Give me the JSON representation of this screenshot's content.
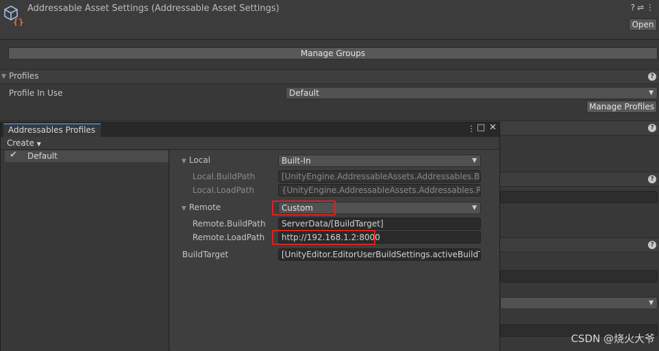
{
  "inspector": {
    "title": "Addressable Asset Settings (Addressable Asset Settings)",
    "open_label": "Open",
    "manage_groups_label": "Manage Groups"
  },
  "profiles_section": {
    "header": "Profiles",
    "profile_in_use_label": "Profile In Use",
    "profile_in_use_value": "Default",
    "manage_profiles_label": "Manage Profiles"
  },
  "profiles_window": {
    "tab_label": "Addressables Profiles",
    "create_label": "Create",
    "profiles": [
      {
        "name": "Default",
        "selected": true
      }
    ],
    "local": {
      "label": "Local",
      "value": "Built-In",
      "build_path_label": "Local.BuildPath",
      "build_path_value": "[UnityEngine.AddressableAssets.Addressables.BuildPath]",
      "load_path_label": "Local.LoadPath",
      "load_path_value": "{UnityEngine.AddressableAssets.Addressables.RuntimePath}"
    },
    "remote": {
      "label": "Remote",
      "value": "Custom",
      "build_path_label": "Remote.BuildPath",
      "build_path_value": "ServerData/[BuildTarget]",
      "load_path_label": "Remote.LoadPath",
      "load_path_value": "http://192.168.1.2:8000"
    },
    "build_target_label": "BuildTarget",
    "build_target_value": "[UnityEditor.EditorUserBuildSettings.activeBuildTarget]"
  },
  "highlight_color": "#e0231f",
  "watermark": "CSDN @烧火大爷"
}
